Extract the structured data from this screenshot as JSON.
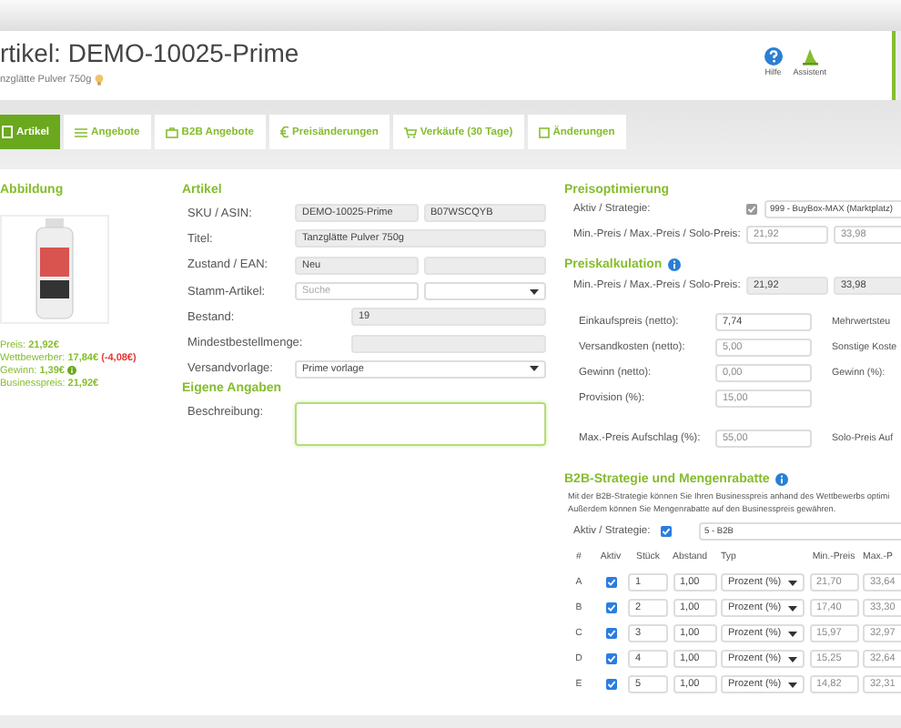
{
  "header": {
    "title": "rtikel: DEMO-10025-Prime",
    "subtitle": "nzglätte Pulver 750g",
    "actions": [
      {
        "label": "Hilfe",
        "kind": "help"
      },
      {
        "label": "Assistent",
        "kind": "assistant"
      }
    ]
  },
  "tabs": [
    {
      "label": "Artikel",
      "selected": true
    },
    {
      "label": "Angebote",
      "selected": false
    },
    {
      "label": "B2B Angebote",
      "selected": false
    },
    {
      "label": "Preisänderungen",
      "selected": false
    },
    {
      "label": "Verkäufe (30 Tage)",
      "selected": false
    },
    {
      "label": "Änderungen",
      "selected": false
    }
  ],
  "image_panel": {
    "heading": "Abbildung",
    "prices": [
      {
        "kind": "plain",
        "label": "Preis:",
        "value": "21,92€"
      },
      {
        "kind": "competitor",
        "label": "Wettbewerber:",
        "value": "17,84€",
        "delta": "(-4,08€)"
      },
      {
        "kind": "profit",
        "label": "Gewinn:",
        "value": "1,39€"
      },
      {
        "kind": "plain",
        "label": "Businesspreis:",
        "value": "21,92€"
      }
    ]
  },
  "article": {
    "heading": "Artikel",
    "rows": [
      {
        "kind": "pair",
        "label": "SKU / ASIN:",
        "fields": [
          {
            "kind": "readonly",
            "value": "DEMO-10025-Prime"
          },
          {
            "kind": "readonly",
            "value": "B07WSCQYB"
          }
        ]
      },
      {
        "kind": "wide",
        "label": "Titel:",
        "fields": [
          {
            "kind": "readonly",
            "value": "Tanzglätte Pulver 750g"
          }
        ]
      },
      {
        "kind": "pair",
        "label": "Zustand / EAN:",
        "fields": [
          {
            "kind": "readonly",
            "value": "Neu"
          },
          {
            "kind": "readonly"
          }
        ]
      },
      {
        "kind": "pair",
        "label": "Stamm-Artikel:",
        "fields": [
          {
            "kind": "text",
            "placeholder": "Suche"
          },
          {
            "kind": "select"
          }
        ]
      },
      {
        "kind": "short",
        "label": "Bestand:",
        "fields": [
          {
            "kind": "readonly",
            "value": "19"
          }
        ]
      },
      {
        "kind": "short",
        "label": "Mindestbestellmenge:",
        "fields": [
          {
            "kind": "readonly"
          }
        ]
      },
      {
        "kind": "wide",
        "label": "Versandvorlage:",
        "fields": [
          {
            "kind": "select",
            "value": "Prime vorlage"
          }
        ]
      }
    ],
    "own_heading": "Eigene Angaben",
    "description": {
      "label": "Beschreibung:"
    }
  },
  "price_optimization": {
    "heading": "Preisoptimierung",
    "strategy": {
      "label": "Aktiv / Strategie:",
      "checked": true,
      "disabled": true,
      "value": "999 - BuyBox-MAX (Marktplatz)"
    },
    "limits": {
      "label": "Min.-Preis / Max.-Preis / Solo-Preis:",
      "fields": [
        {
          "kind": "muted",
          "value": "21,92"
        },
        {
          "kind": "muted",
          "value": "33,98"
        }
      ]
    }
  },
  "price_calculation": {
    "heading": "Preiskalkulation",
    "limits": {
      "label": "Min.-Preis / Max.-Preis / Solo-Preis:",
      "fields": [
        {
          "kind": "readonly",
          "value": "21,92"
        },
        {
          "kind": "readonly",
          "value": "33,98"
        }
      ]
    },
    "rows": [
      {
        "label": "Einkaufspreis (netto):",
        "field": {
          "kind": "text",
          "value": "7,74"
        },
        "side_label": "Mehrwertsteu"
      },
      {
        "label": "Versandkosten (netto):",
        "field": {
          "kind": "muted",
          "value": "5,00"
        },
        "side_label": "Sonstige Koste"
      },
      {
        "label": "Gewinn (netto):",
        "field": {
          "kind": "muted",
          "value": "0,00"
        },
        "side_label": "Gewinn (%):"
      },
      {
        "label": "Provision (%):",
        "field": {
          "kind": "muted",
          "value": "15,00"
        }
      },
      {
        "label": "Max.-Preis Aufschlag (%):",
        "field": {
          "kind": "muted",
          "value": "55,00"
        },
        "side_label": "Solo-Preis Auf"
      }
    ]
  },
  "b2b": {
    "heading": "B2B-Strategie und Mengenrabatte",
    "description": [
      "Mit der B2B-Strategie können Sie Ihren Businesspreis anhand des Wettbewerbs optimi",
      "Außerdem können Sie Mengenrabatte auf den Businesspreis gewähren."
    ],
    "strategy": {
      "label": "Aktiv / Strategie:",
      "checked": true,
      "disabled": false,
      "value": "5 - B2B"
    },
    "columns": [
      "#",
      "Aktiv",
      "Stück",
      "Abstand",
      "Typ",
      "Min.-Preis",
      "Max.-P"
    ],
    "rows": [
      {
        "id": "A",
        "active": true,
        "quantity": "1",
        "distance": "1,00",
        "type": "Prozent (%)",
        "min": "21,70",
        "max": "33,64"
      },
      {
        "id": "B",
        "active": true,
        "quantity": "2",
        "distance": "1,00",
        "type": "Prozent (%)",
        "min": "17,40",
        "max": "33,30"
      },
      {
        "id": "C",
        "active": true,
        "quantity": "3",
        "distance": "1,00",
        "type": "Prozent (%)",
        "min": "15,97",
        "max": "32,97"
      },
      {
        "id": "D",
        "active": true,
        "quantity": "4",
        "distance": "1,00",
        "type": "Prozent (%)",
        "min": "15,25",
        "max": "32,64"
      },
      {
        "id": "E",
        "active": true,
        "quantity": "5",
        "distance": "1,00",
        "type": "Prozent (%)",
        "min": "14,82",
        "max": "32,31"
      }
    ]
  }
}
